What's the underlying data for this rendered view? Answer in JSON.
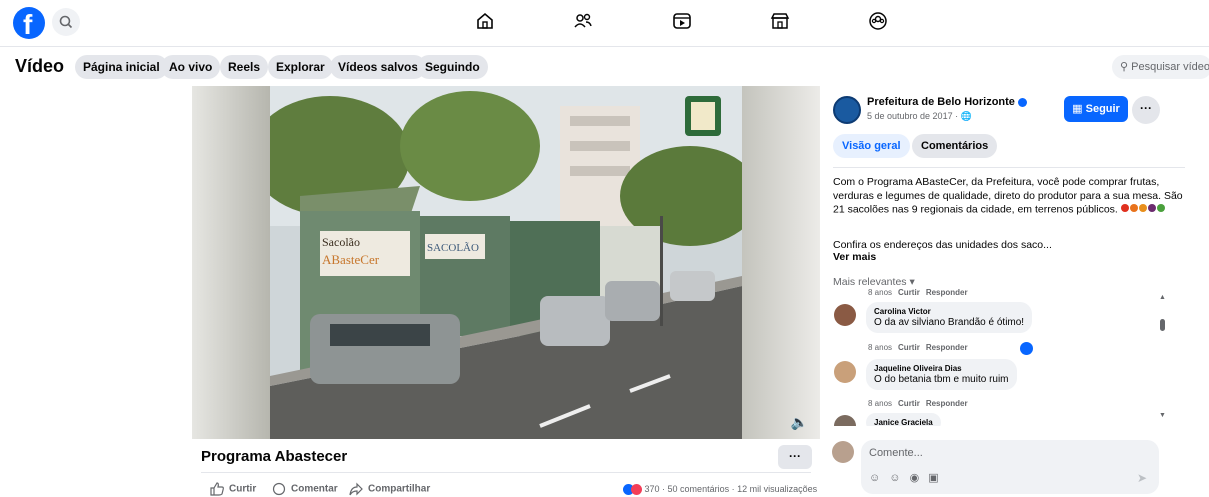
{
  "colors": {
    "brand": "#0866ff",
    "bg_secondary": "#f0f2f5",
    "muted": "#65676b"
  },
  "topbar": {
    "logo_icon": "facebook-logo-icon",
    "search_icon": "search-icon",
    "nav_icons": [
      "home-icon",
      "friends-icon",
      "video-icon",
      "marketplace-icon",
      "groups-icon"
    ]
  },
  "video_nav": {
    "title": "Vídeo",
    "tabs": [
      "Página inicial",
      "Ao vivo",
      "Reels",
      "Explorar",
      "Vídeos salvos",
      "Seguindo"
    ],
    "search_placeholder": "Pesquisar vídeo"
  },
  "post": {
    "title": "Programa Abastecer",
    "more_label": "···",
    "actions": {
      "like": "Curtir",
      "comment": "Comentar",
      "share": "Compartilhar"
    },
    "reaction_count": "370",
    "stats": " · 50 comentários · 12 mil visualizações"
  },
  "page": {
    "name": "Prefeitura de Belo Horizonte",
    "date": "5 de outubro de 2017 ·",
    "follow_label": "Seguir",
    "more_label": "···"
  },
  "panel_tabs": {
    "overview": "Visão geral",
    "comments": "Comentários"
  },
  "description": {
    "text": "Com o Programa ABasteCer, da Prefeitura, você pode comprar frutas, verduras e legumes de qualidade, direto do produtor para a sua mesa. São 21 sacolões nas 9 regionais da cidade, em terrenos públicos.",
    "address_line": "Confira os endereços das unidades dos saco...",
    "see_more": "Ver mais"
  },
  "sort_label": "Mais relevantes ▾",
  "comments": [
    {
      "meta_time": "8 anos",
      "like": "Curtir",
      "reply": "Responder"
    },
    {
      "author": "Carolina Victor",
      "text": "O da av silviano Brandão é ótimo!",
      "meta_time": "8 anos",
      "like": "Curtir",
      "reply": "Responder"
    },
    {
      "author": "Jaqueline Oliveira Dias",
      "text": "O do betania tbm e muito ruim",
      "meta_time": "8 anos",
      "like": "Curtir",
      "reply": "Responder"
    },
    {
      "author": "Janice Graciela"
    }
  ],
  "composer": {
    "placeholder": "Comente..."
  }
}
